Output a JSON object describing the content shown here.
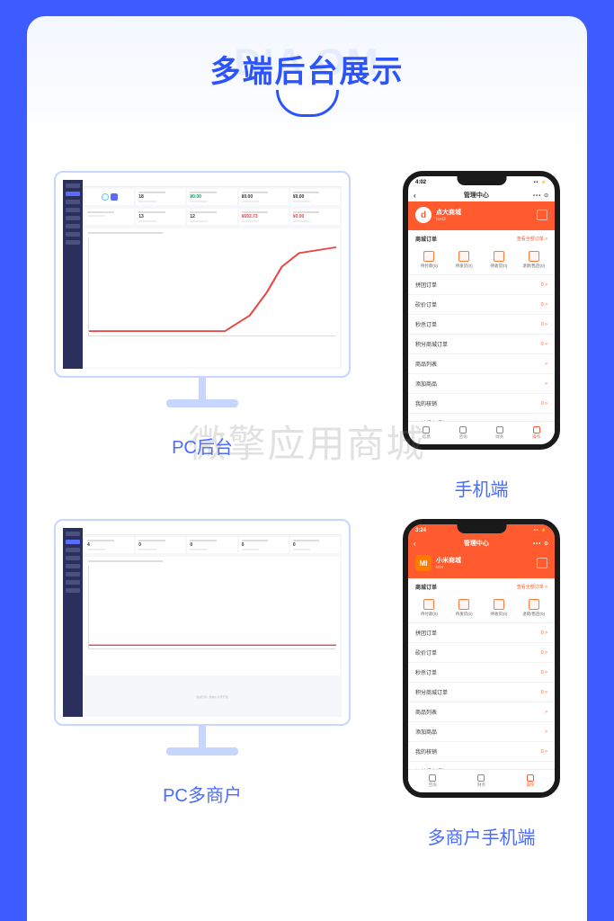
{
  "title": {
    "bg": "DIA                    OM",
    "fg": "多端后台展示"
  },
  "watermark": "微擎应用商城",
  "sections": [
    {
      "pc_caption": "PC后台",
      "mobile_caption": "手机端",
      "dashboard": {
        "stats_row1": [
          {
            "type": "logo"
          },
          {
            "lbl": "",
            "val": "18",
            "cls": ""
          },
          {
            "lbl": "",
            "val": "¥0.00",
            "cls": "green"
          },
          {
            "lbl": "",
            "val": "¥0.00",
            "cls": ""
          },
          {
            "lbl": "",
            "val": "¥0.00",
            "cls": ""
          }
        ],
        "stats_row2": [
          {
            "lbl": "",
            "val": "",
            "cls": ""
          },
          {
            "lbl": "",
            "val": "13",
            "cls": ""
          },
          {
            "lbl": "",
            "val": "12",
            "cls": ""
          },
          {
            "lbl": "",
            "val": "¥692.73",
            "cls": "red"
          },
          {
            "lbl": "",
            "val": "¥0.00",
            "cls": "red"
          }
        ]
      },
      "mobile": {
        "time": "4:02",
        "nav_title": "管理中心",
        "shop_name": "点大商城",
        "shop_sub": "test3",
        "shop_logo_text": "d",
        "shop_logo_class": "",
        "status_class": "",
        "order_head_l": "商城订单",
        "order_head_r": "查看全部订单 >",
        "order_tabs": [
          "待付款(0)",
          "待发货(0)",
          "待收货(0)",
          "退款/售后(0)"
        ],
        "menu": [
          {
            "l": "拼团订单",
            "r": "0 >"
          },
          {
            "l": "砍价订单",
            "r": "0 >"
          },
          {
            "l": "秒杀订单",
            "r": "0 >"
          },
          {
            "l": "积分商城订单",
            "r": "0 >"
          },
          {
            "l": "商品列表",
            "r": ">"
          },
          {
            "l": "添加商品",
            "r": ">"
          },
          {
            "l": "我的核销",
            "r": "0 >"
          },
          {
            "l": "订单提交通知",
            "r": ""
          }
        ],
        "tabs": [
          {
            "l": "信息",
            "active": false
          },
          {
            "l": "咨询",
            "active": false
          },
          {
            "l": "财务",
            "active": false
          },
          {
            "l": "操作",
            "active": true
          }
        ]
      }
    },
    {
      "pc_caption": "PC多商户",
      "mobile_caption": "多商户手机端",
      "dashboard": {
        "stats_row1": [
          {
            "lbl": "",
            "val": "4",
            "cls": ""
          },
          {
            "lbl": "",
            "val": "0",
            "cls": ""
          },
          {
            "lbl": "",
            "val": "0",
            "cls": ""
          },
          {
            "lbl": "",
            "val": "0",
            "cls": ""
          },
          {
            "lbl": "",
            "val": "0",
            "cls": ""
          }
        ],
        "footer": "微信扫码 | 微信公众号开发"
      },
      "mobile": {
        "time": "3:24",
        "nav_title": "管理中心",
        "shop_name": "小米商城",
        "shop_sub": "test",
        "shop_logo_text": "MI",
        "shop_logo_class": "mi",
        "status_class": "orange",
        "order_head_l": "商城订单",
        "order_head_r": "查看全部订单 >",
        "order_tabs": [
          "待付款(0)",
          "待发货(0)",
          "待收货(0)",
          "退款/售后(0)"
        ],
        "menu": [
          {
            "l": "拼团订单",
            "r": "0 >"
          },
          {
            "l": "砍价订单",
            "r": "0 >"
          },
          {
            "l": "秒杀订单",
            "r": "0 >"
          },
          {
            "l": "积分商城订单",
            "r": "0 >"
          },
          {
            "l": "商品列表",
            "r": ">"
          },
          {
            "l": "添加商品",
            "r": ">"
          },
          {
            "l": "我的核销",
            "r": "0 >"
          },
          {
            "l": "订单提交通知",
            "r": ""
          }
        ],
        "tabs": [
          {
            "l": "咨询",
            "active": false
          },
          {
            "l": "财务",
            "active": false
          },
          {
            "l": "操作",
            "active": true
          }
        ]
      }
    }
  ]
}
